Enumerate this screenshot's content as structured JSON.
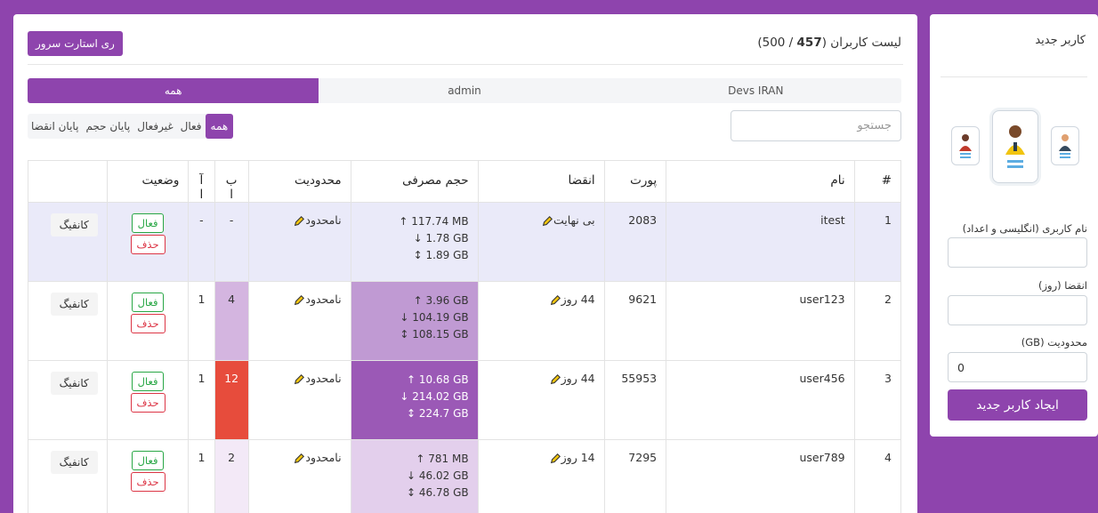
{
  "sidebar": {
    "title": "کاربر جدید",
    "username_label": "نام کاربری (انگلیسی و اعداد)",
    "username_value": "",
    "expiry_label": "انقضا (روز)",
    "expiry_value": "",
    "limit_label": "محدودیت (GB)",
    "limit_value": "0",
    "create_button": "ایجاد کاربر جدید"
  },
  "main": {
    "title_prefix": "لیست کاربران (",
    "user_count": "457",
    "title_suffix": " / 500)",
    "restart_button": "ری استارت سرور",
    "tabs": [
      {
        "label": "همه",
        "active": true
      },
      {
        "label": "admin",
        "active": false
      },
      {
        "label": "Devs IRAN",
        "active": false
      }
    ],
    "search_placeholder": "جستجو",
    "filters": [
      {
        "label": "همه",
        "active": true
      },
      {
        "label": "فعال",
        "active": false
      },
      {
        "label": "غیرفعال",
        "active": false
      },
      {
        "label": "پایان حجم",
        "active": false
      },
      {
        "label": "پایان انقضا",
        "active": false
      }
    ],
    "columns": [
      "#",
      "نام",
      "پورت",
      "انقضا",
      "حجم مصرفی",
      "محدودیت",
      "ب ا",
      "آ ا",
      "وضعیت",
      ""
    ],
    "status_active": "فعال",
    "status_delete": "حذف",
    "config_button": "کانفیگ",
    "rows": [
      {
        "num": "1",
        "name": "itest",
        "port": "2083",
        "expiry": "بی نهایت",
        "up": "↑ 117.74 MB",
        "down": "↓ 1.78 GB",
        "total": "↕ 1.89 GB",
        "limit": "نامحدود",
        "b": "-",
        "a": "-",
        "traffic_color": "#eaeaf9",
        "b_color": "#eaeaf9"
      },
      {
        "num": "2",
        "name": "user123",
        "port": "9621",
        "expiry": "44 روز",
        "up": "↑ 3.96 GB",
        "down": "↓ 104.19 GB",
        "total": "↕ 108.15 GB",
        "limit": "نامحدود",
        "b": "4",
        "a": "1",
        "traffic_color": "#c09ad3",
        "b_color": "#d4b5e0"
      },
      {
        "num": "3",
        "name": "user456",
        "port": "55953",
        "expiry": "44 روز",
        "up": "↑ 10.68 GB",
        "down": "↓ 214.02 GB",
        "total": "↕ 224.7 GB",
        "limit": "نامحدود",
        "b": "12",
        "a": "1",
        "traffic_color": "#9b59b6",
        "b_color": "#e74c3c"
      },
      {
        "num": "4",
        "name": "user789",
        "port": "7295",
        "expiry": "14 روز",
        "up": "↑ 781 MB",
        "down": "↓ 46.02 GB",
        "total": "↕ 46.78 GB",
        "limit": "نامحدود",
        "b": "2",
        "a": "1",
        "traffic_color": "#e3cfec",
        "b_color": "#f3e9f7"
      }
    ]
  },
  "colors": {
    "accent": "#8e44ad",
    "active_green": "#28a745",
    "delete_red": "#dc3545"
  }
}
